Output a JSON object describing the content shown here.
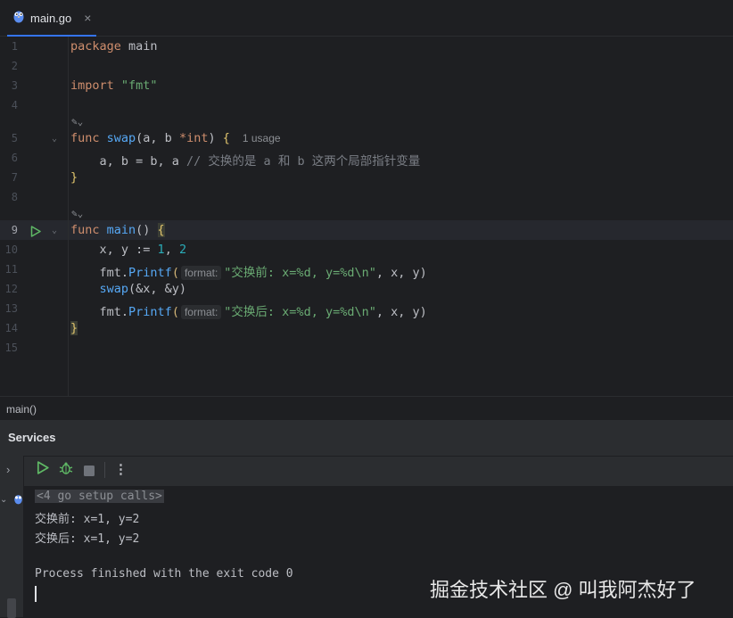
{
  "tab": {
    "title": "main.go",
    "close": "×",
    "icon": "gopher-icon"
  },
  "line_numbers": [
    "1",
    "2",
    "3",
    "4",
    "5",
    "6",
    "7",
    "8",
    "9",
    "10",
    "11",
    "12",
    "13",
    "14",
    "15"
  ],
  "code": {
    "l1_kw": "package",
    "l1_rest": " main",
    "l3_kw": "import",
    "l3_str": " \"fmt\"",
    "ai_hint": "✎⌄",
    "l5_kw": "func",
    "l5_fn": " swap",
    "l5_params": "(a, b ",
    "l5_type": "*int",
    "l5_close": ") ",
    "l5_brace": "{",
    "l5_usage": "1 usage",
    "l6_code": "    a, b = b, a ",
    "l6_comment": "// 交换的是 a 和 b 这两个局部指针变量",
    "l7_brace": "}",
    "l9_kw": "func",
    "l9_fn": " main",
    "l9_paren": "() ",
    "l9_brace": "{",
    "l10_a": "    x, y := ",
    "l10_n1": "1",
    "l10_sep": ", ",
    "l10_n2": "2",
    "l11_a": "    fmt.",
    "l11_fn": "Printf",
    "l11_p": "(",
    "l11_hint": "format:",
    "l11_str": "\"交换前: x=%d, y=%d\\n\"",
    "l11_rest": ", x, y)",
    "l12_a": "    ",
    "l12_fn": "swap",
    "l12_rest": "(&x, &y)",
    "l13_a": "    fmt.",
    "l13_fn": "Printf",
    "l13_p": "(",
    "l13_hint": "format:",
    "l13_str": "\"交换后: x=%d, y=%d\\n\"",
    "l13_rest": ", x, y)",
    "l14_brace": "}"
  },
  "breadcrumb": "main()",
  "services": {
    "title": "Services",
    "console": {
      "setup": "<4 go setup calls>",
      "line1": "交换前: x=1, y=2",
      "line2": "交换后: x=1, y=2",
      "line3": "Process finished with the exit code 0"
    }
  },
  "watermark": "掘金技术社区 @ 叫我阿杰好了",
  "colors": {
    "accent": "#3574f0",
    "keyword": "#cf8e6d",
    "function": "#56a8f5",
    "string": "#6aab73",
    "number": "#2aacb8",
    "run": "#5fb865"
  }
}
